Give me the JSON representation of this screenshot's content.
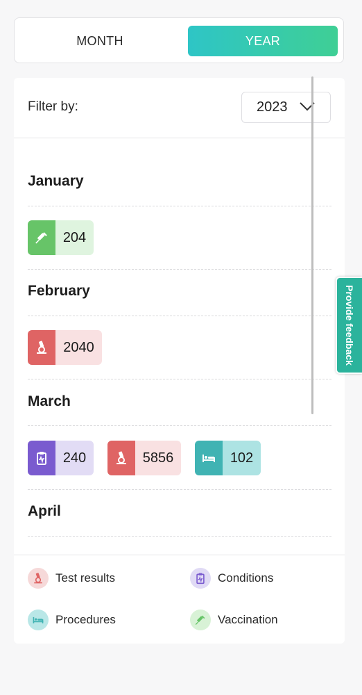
{
  "toggle": {
    "month_label": "MONTH",
    "year_label": "YEAR",
    "active": "YEAR"
  },
  "filter": {
    "label": "Filter by:",
    "year_value": "2023"
  },
  "months": [
    {
      "name": "January",
      "chips": [
        {
          "type": "vaccination",
          "value": "204"
        }
      ]
    },
    {
      "name": "February",
      "chips": [
        {
          "type": "test-results",
          "value": "2040"
        }
      ]
    },
    {
      "name": "March",
      "chips": [
        {
          "type": "conditions",
          "value": "240"
        },
        {
          "type": "test-results",
          "value": "5856"
        },
        {
          "type": "procedures",
          "value": "102"
        }
      ]
    },
    {
      "name": "April",
      "chips": []
    }
  ],
  "legend": {
    "test_results": "Test results",
    "conditions": "Conditions",
    "procedures": "Procedures",
    "vaccination": "Vaccination"
  },
  "feedback_label": "Provide feedback",
  "colors": {
    "accent_start": "#2ec5c6",
    "accent_end": "#3fcf95",
    "vaccination": "#67c468",
    "test_results": "#df6464",
    "conditions": "#7a5bcf",
    "procedures": "#40b3b3",
    "feedback": "#2bb39c"
  },
  "icons": {
    "vaccination": "syringe-icon",
    "test_results": "microscope-icon",
    "conditions": "clipboard-pulse-icon",
    "procedures": "hospital-bed-icon"
  }
}
